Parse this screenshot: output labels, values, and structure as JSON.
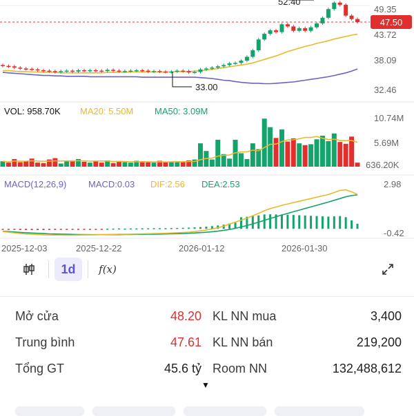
{
  "price_axis": {
    "labels": [
      "49.35",
      "43.72",
      "38.09",
      "32.46"
    ],
    "current_price": "47.50"
  },
  "annotations": {
    "high": "52.40",
    "low": "33.00"
  },
  "volume": {
    "vol_label": "VOL: 958.70K",
    "ma20_label": "MA20: 5.50M",
    "ma50_label": "MA50: 3.09M",
    "axis": [
      "10.74M",
      "5.69M",
      "636.20K"
    ]
  },
  "macd": {
    "title": "MACD(12,26,9)",
    "macd_label": "MACD:0.03",
    "dif_label": "DIF:2.56",
    "dea_label": "DEA:2.53",
    "axis": [
      "2.98",
      "-0.42"
    ]
  },
  "dates": [
    "2025-12-03",
    "2025-12-22",
    "2026-01-12",
    "2026-01-30"
  ],
  "toolbar": {
    "candle_icon": "candlestick-icon",
    "interval": "1d",
    "fx_label": "f(x)",
    "expand_icon": "expand-icon"
  },
  "stats": {
    "open_label": "Mở cửa",
    "open_value": "48.20",
    "avg_label": "Trung bình",
    "avg_value": "47.61",
    "total_label": "Tổng GT",
    "total_value": "45.6 tỷ",
    "nn_buy_label": "KL NN mua",
    "nn_buy_value": "3,400",
    "nn_sell_label": "KL NN bán",
    "nn_sell_value": "219,200",
    "room_label": "Room NN",
    "room_value": "132,488,612"
  },
  "colors": {
    "up": "#13a36b",
    "down": "#e0302e",
    "ma20": "#e8b92a",
    "ma50": "#13a36b",
    "macd": "#6b62c7"
  },
  "chart_data": {
    "type": "candlestick",
    "closes": [
      37.4,
      37.3,
      37.0,
      36.8,
      36.7,
      36.6,
      36.4,
      36.3,
      36.2,
      36.0,
      36.2,
      36.3,
      36.1,
      36.4,
      36.3,
      36.4,
      36.3,
      36.2,
      36.5,
      36.3,
      36.2,
      36.2,
      36.3,
      36.4,
      36.3,
      36.1,
      36.2,
      36.1,
      36.0,
      36.1,
      36.3,
      36.2,
      35.9,
      36.0,
      36.6,
      36.8,
      37.0,
      37.3,
      37.6,
      38.0,
      38.1,
      38.6,
      39.5,
      41.0,
      43.5,
      44.8,
      45.6,
      45.2,
      47.0,
      46.5,
      45.5,
      46.1,
      45.5,
      46.3,
      47.2,
      48.5,
      50.5,
      52.0,
      51.5,
      49.0,
      48.2,
      47.5
    ],
    "volume": [
      1.2,
      0.9,
      1.7,
      1.0,
      1.3,
      1.8,
      0.9,
      0.8,
      1.6,
      1.9,
      0.7,
      1.2,
      1.4,
      1.7,
      1.1,
      0.9,
      1.3,
      0.9,
      1.4,
      0.8,
      1.1,
      1.0,
      0.9,
      1.3,
      1.2,
      1.0,
      0.9,
      1.3,
      1.0,
      1.1,
      1.2,
      1.0,
      1.4,
      1.6,
      5.2,
      3.5,
      1.6,
      6.0,
      2.8,
      1.8,
      6.0,
      3.0,
      1.7,
      5.2,
      3.9,
      10.7,
      8.8,
      6.4,
      8.3,
      5.6,
      6.3,
      5.2,
      4.8,
      5.0,
      6.1,
      6.9,
      5.7,
      7.4,
      5.5,
      5.1,
      6.7,
      0.9
    ],
    "ma20": [
      36.3,
      36.3,
      36.2,
      36.1,
      36.1,
      36.0,
      36.0,
      35.9,
      35.9,
      35.9,
      35.8,
      35.8,
      35.8,
      35.8,
      35.8,
      35.8,
      35.8,
      35.8,
      35.9,
      35.9,
      35.9,
      35.9,
      36.0,
      36.0,
      36.0,
      36.0,
      36.0,
      36.0,
      36.0,
      36.0,
      36.1,
      36.1,
      36.1,
      36.2,
      36.3,
      36.4,
      36.6,
      36.8,
      37.0,
      37.2,
      37.4,
      37.6,
      37.8,
      38.1,
      38.5,
      38.9,
      39.3,
      39.7,
      40.2,
      40.7,
      41.1,
      41.5,
      41.9,
      42.2,
      42.6,
      42.9,
      43.2,
      43.6,
      43.9,
      44.2,
      44.5,
      44.7
    ],
    "ma50": [
      35.9,
      35.8,
      35.7,
      35.6,
      35.5,
      35.4,
      35.3,
      35.2,
      35.2,
      35.1,
      35.1,
      35.0,
      35.0,
      35.0,
      35.0,
      34.9,
      34.9,
      34.9,
      34.9,
      34.9,
      34.9,
      34.9,
      34.9,
      34.9,
      34.8,
      34.8,
      34.8,
      34.8,
      34.8,
      34.8,
      34.8,
      34.8,
      34.8,
      34.8,
      34.7,
      34.6,
      34.5,
      34.3,
      34.1,
      34.0,
      33.8,
      33.6,
      33.5,
      33.4,
      33.4,
      33.3,
      33.3,
      33.4,
      33.5,
      33.6,
      33.7,
      33.9,
      34.1,
      34.3,
      34.5,
      34.7,
      34.9,
      35.2,
      35.5,
      35.8,
      36.2,
      36.7
    ],
    "dif": [
      -0.2,
      -0.25,
      -0.3,
      -0.35,
      -0.38,
      -0.4,
      -0.42,
      -0.44,
      -0.45,
      -0.46,
      -0.46,
      -0.47,
      -0.47,
      -0.46,
      -0.45,
      -0.45,
      -0.44,
      -0.43,
      -0.42,
      -0.41,
      -0.4,
      -0.4,
      -0.39,
      -0.38,
      -0.37,
      -0.36,
      -0.35,
      -0.34,
      -0.33,
      -0.31,
      -0.29,
      -0.27,
      -0.24,
      -0.2,
      -0.15,
      -0.09,
      -0.01,
      0.08,
      0.2,
      0.35,
      0.5,
      0.65,
      0.8,
      0.97,
      1.15,
      1.35,
      1.5,
      1.62,
      1.75,
      1.85,
      1.95,
      2.05,
      2.15,
      2.25,
      2.35,
      2.45,
      2.55,
      2.7,
      2.85,
      2.9,
      2.75,
      2.56
    ],
    "dea": [
      -0.18,
      -0.2,
      -0.23,
      -0.26,
      -0.29,
      -0.31,
      -0.33,
      -0.35,
      -0.37,
      -0.38,
      -0.39,
      -0.4,
      -0.41,
      -0.42,
      -0.42,
      -0.43,
      -0.43,
      -0.43,
      -0.43,
      -0.43,
      -0.43,
      -0.42,
      -0.42,
      -0.41,
      -0.41,
      -0.4,
      -0.4,
      -0.39,
      -0.38,
      -0.37,
      -0.36,
      -0.35,
      -0.33,
      -0.31,
      -0.28,
      -0.25,
      -0.21,
      -0.17,
      -0.11,
      -0.05,
      0.04,
      0.14,
      0.25,
      0.37,
      0.5,
      0.63,
      0.77,
      0.9,
      1.03,
      1.15,
      1.27,
      1.39,
      1.51,
      1.63,
      1.75,
      1.87,
      1.99,
      2.12,
      2.25,
      2.38,
      2.47,
      2.53
    ],
    "y_range_price": [
      31.0,
      52.6
    ],
    "y_range_volume": [
      0,
      10.74
    ],
    "y_range_macd": [
      -0.6,
      2.98
    ]
  }
}
